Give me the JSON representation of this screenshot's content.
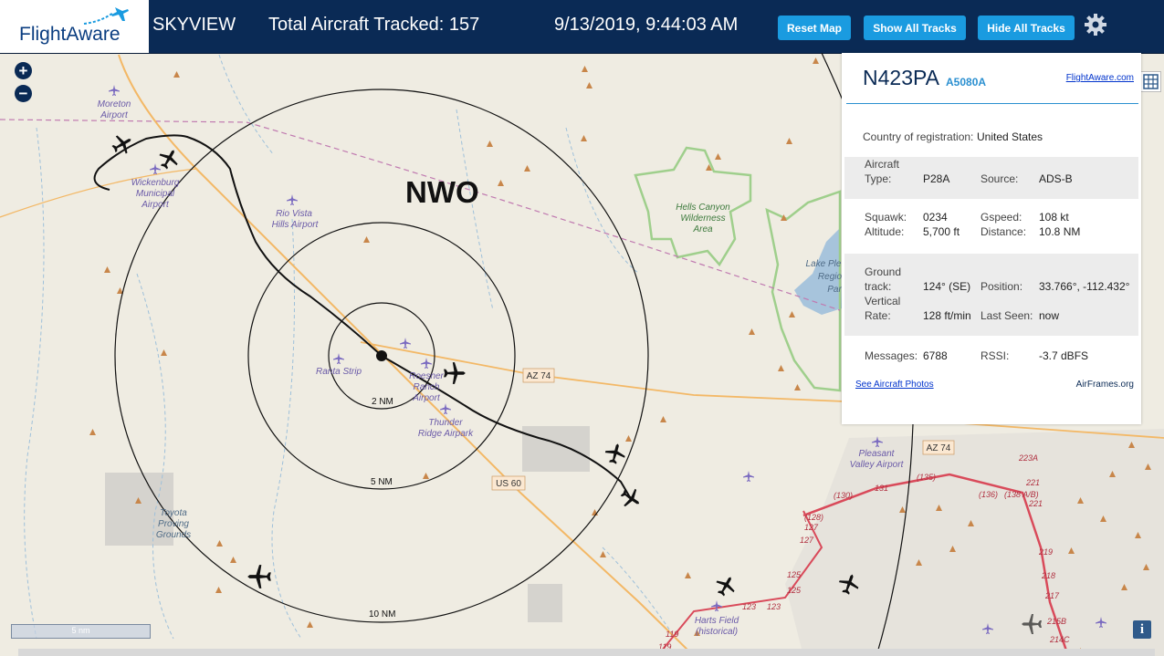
{
  "header": {
    "logo_text": "FlightAware",
    "app_name": "SKYVIEW",
    "tracked": "Total Aircraft Tracked: 157",
    "datetime": "9/13/2019, 9:44:03 AM",
    "buttons": {
      "reset": "Reset Map",
      "show_all": "Show All Tracks",
      "hide_all": "Hide All Tracks"
    },
    "settings_icon": "gear-icon"
  },
  "map": {
    "site_label": "NWO",
    "rings": [
      "2 NM",
      "5 NM",
      "10 NM"
    ],
    "scale_label": "5 nm",
    "zoom_in": "+",
    "zoom_out": "−",
    "info_label": "i",
    "places": {
      "moreton": [
        "Moreton",
        "Airport"
      ],
      "wickenburg": [
        "Wickenburg",
        "Municipal",
        "Airport"
      ],
      "riovista": [
        "Rio Vista",
        "Hills Airport"
      ],
      "hells": [
        "Hells Canyon",
        "Wilderness",
        "Area"
      ],
      "lake": [
        "Lake Ple",
        "Regio",
        "Par"
      ],
      "ranta": "Ranta Strip",
      "roesner": [
        "Roesner",
        "Ranch",
        "Airport"
      ],
      "thunder": [
        "Thunder",
        "Ridge Airpark"
      ],
      "toyota": [
        "Toyota",
        "Proving",
        "Grounds"
      ],
      "pleasant": [
        "Pleasant",
        "Valley Airport"
      ],
      "harts": [
        "Harts Field",
        "(historical)"
      ]
    },
    "shields": {
      "az74a": "AZ 74",
      "az74b": "AZ 74",
      "us60": "US 60"
    },
    "road_numbers": [
      "(135)",
      "(130)",
      "131",
      "(136)",
      "(138 A/B)",
      "223A",
      "221",
      "221",
      "(128)",
      "127",
      "127",
      "125",
      "125",
      "219",
      "218",
      "217",
      "123",
      "123",
      "215B",
      "214C",
      "119",
      "119"
    ]
  },
  "panel": {
    "ident": "N423PA",
    "hex": "A5080A",
    "link": "FlightAware.com",
    "country_label": "Country of registration:",
    "country": "United States",
    "type_label": [
      "Aircraft",
      "Type:"
    ],
    "type": "P28A",
    "source_label": "Source:",
    "source": "ADS-B",
    "squawk_label": "Squawk:",
    "squawk": "0234",
    "gspeed_label": "Gspeed:",
    "gspeed": "108 kt",
    "altitude_label": "Altitude:",
    "altitude": "5,700 ft",
    "distance_label": "Distance:",
    "distance": "10.8 NM",
    "track_label": [
      "Ground",
      "track:"
    ],
    "track": "124° (SE)",
    "position_label": "Position:",
    "position": "33.766°, -112.432°",
    "vrate_label": [
      "Vertical",
      "Rate:"
    ],
    "vrate": "128 ft/min",
    "lastseen_label": "Last Seen:",
    "lastseen": "now",
    "messages_label": "Messages:",
    "messages": "6788",
    "rssi_label": "RSSI:",
    "rssi": "-3.7 dBFS",
    "photos_link": "See Aircraft Photos",
    "airframes": "AirFrames.org"
  },
  "colors": {
    "header_bg": "#0a2a55",
    "button": "#1a9be0",
    "map_bg": "#efece2",
    "road": "#f3b866",
    "highway": "#d94a5a",
    "terrain": "#c8864a"
  }
}
